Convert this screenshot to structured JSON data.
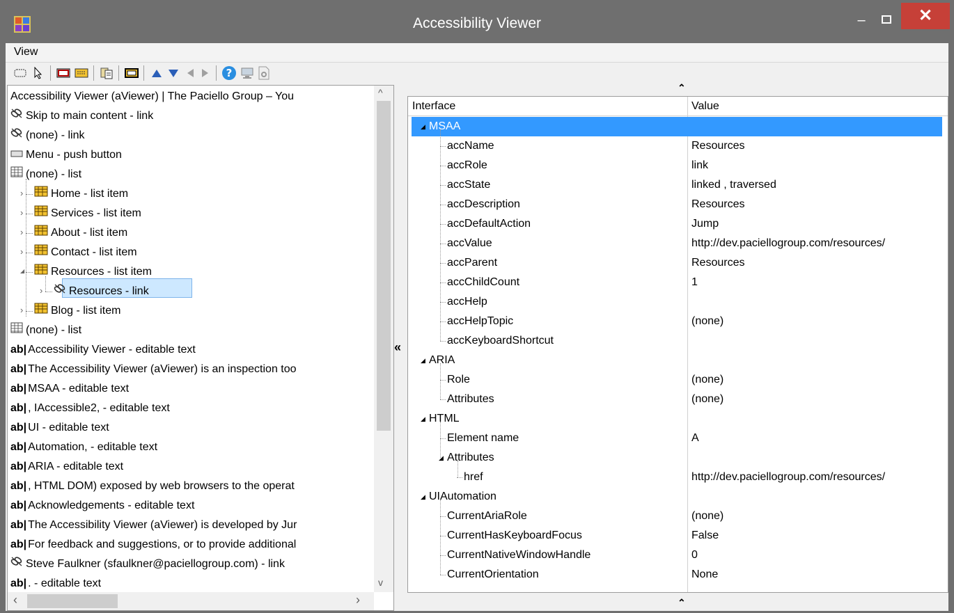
{
  "window": {
    "title": "Accessibility Viewer",
    "controls": {
      "minimize": "–",
      "close": "✕"
    }
  },
  "menu": {
    "view": "View"
  },
  "toolbar": {
    "buttons": [
      "select-region-icon",
      "pointer-icon",
      "highlight-red-icon",
      "highlight-yellow-icon",
      "copy-icon",
      "focus-rectangle-icon",
      "arrow-up-icon",
      "arrow-down-icon",
      "arrow-left-icon",
      "arrow-right-icon",
      "help-icon",
      "monitor-icon",
      "settings-page-icon"
    ]
  },
  "tree": {
    "rows": [
      {
        "icon": "none",
        "label": "Accessibility Viewer (aViewer) | The Paciello Group – You"
      },
      {
        "icon": "link",
        "label": "Skip to main content - link"
      },
      {
        "icon": "link",
        "label": "(none) - link"
      },
      {
        "icon": "button",
        "label": "Menu - push button"
      },
      {
        "icon": "list",
        "label": "(none) - list"
      },
      {
        "icon": "listitem",
        "label": "Home - list item"
      },
      {
        "icon": "listitem",
        "label": "Services - list item"
      },
      {
        "icon": "listitem",
        "label": "About - list item"
      },
      {
        "icon": "listitem",
        "label": "Contact - list item"
      },
      {
        "icon": "listitem",
        "label": "Resources - list item"
      },
      {
        "icon": "link",
        "label": "Resources - link"
      },
      {
        "icon": "listitem",
        "label": "Blog - list item"
      },
      {
        "icon": "list",
        "label": "(none) - list"
      },
      {
        "icon": "text",
        "label": "Accessibility Viewer - editable text"
      },
      {
        "icon": "text",
        "label": "The Accessibility Viewer (aViewer) is an inspection too"
      },
      {
        "icon": "text",
        "label": "MSAA - editable text"
      },
      {
        "icon": "text",
        "label": ", IAccessible2, - editable text"
      },
      {
        "icon": "text",
        "label": "UI - editable text"
      },
      {
        "icon": "text",
        "label": "Automation, - editable text"
      },
      {
        "icon": "text",
        "label": "ARIA - editable text"
      },
      {
        "icon": "text",
        "label": ", HTML DOM) exposed by web browsers to the operat"
      },
      {
        "icon": "text",
        "label": "Acknowledgements - editable text"
      },
      {
        "icon": "text",
        "label": "The Accessibility Viewer (aViewer) is developed by Jur"
      },
      {
        "icon": "text",
        "label": "For feedback and suggestions, or to provide additional"
      },
      {
        "icon": "link",
        "label": "Steve Faulkner (sfaulkner@paciellogroup.com) - link"
      },
      {
        "icon": "text",
        "label": ". - editable text"
      }
    ],
    "ab_glyph": "ab|"
  },
  "properties": {
    "headers": {
      "interface": "Interface",
      "value": "Value"
    },
    "rows": [
      {
        "name": "MSAA",
        "value": "",
        "group": true
      },
      {
        "name": "accName",
        "value": "Resources"
      },
      {
        "name": "accRole",
        "value": "link"
      },
      {
        "name": "accState",
        "value": "linked , traversed"
      },
      {
        "name": "accDescription",
        "value": "Resources"
      },
      {
        "name": "accDefaultAction",
        "value": "Jump"
      },
      {
        "name": "accValue",
        "value": "http://dev.paciellogroup.com/resources/"
      },
      {
        "name": "accParent",
        "value": "Resources"
      },
      {
        "name": "accChildCount",
        "value": "1"
      },
      {
        "name": "accHelp",
        "value": ""
      },
      {
        "name": "accHelpTopic",
        "value": "(none)"
      },
      {
        "name": "accKeyboardShortcut",
        "value": ""
      },
      {
        "name": "ARIA",
        "value": "",
        "group": true
      },
      {
        "name": "Role",
        "value": "(none)"
      },
      {
        "name": "Attributes",
        "value": "(none)"
      },
      {
        "name": "HTML",
        "value": "",
        "group": true
      },
      {
        "name": "Element name",
        "value": "A"
      },
      {
        "name": "Attributes",
        "value": "",
        "group": true
      },
      {
        "name": "href",
        "value": "http://dev.paciellogroup.com/resources/"
      },
      {
        "name": "UIAutomation",
        "value": "",
        "group": true
      },
      {
        "name": "CurrentAriaRole",
        "value": "(none)"
      },
      {
        "name": "CurrentHasKeyboardFocus",
        "value": "False"
      },
      {
        "name": "CurrentNativeWindowHandle",
        "value": "0"
      },
      {
        "name": "CurrentOrientation",
        "value": "None"
      }
    ]
  },
  "splitters": {
    "collapse_left": "«",
    "collapse_up": "«"
  },
  "colors": {
    "selection": "#3399ff",
    "tree_selection": "#cde8ff",
    "close": "#c64038"
  }
}
